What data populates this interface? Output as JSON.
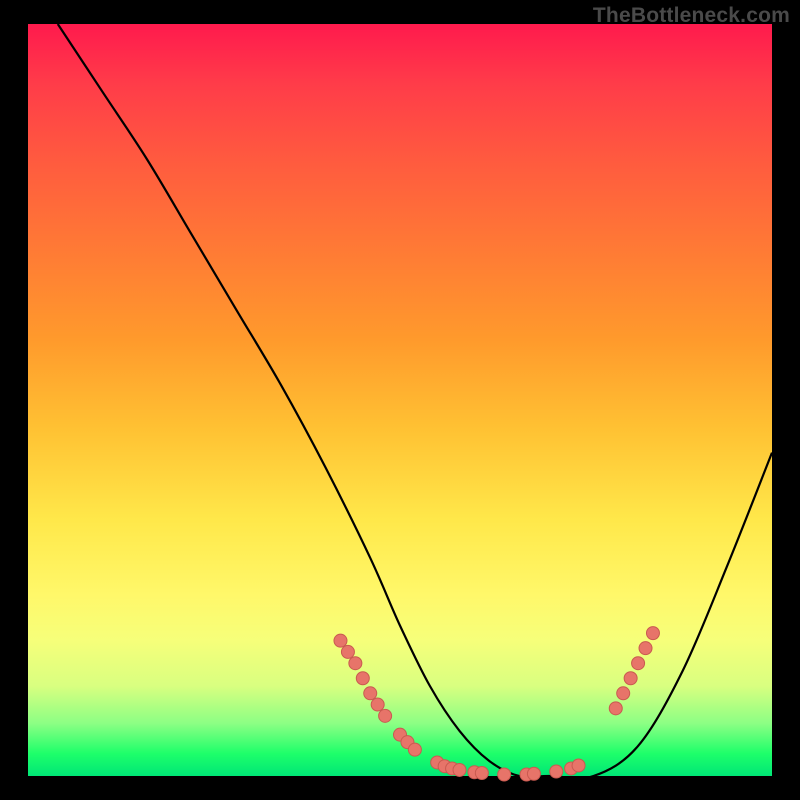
{
  "watermark": "TheBottleneck.com",
  "colors": {
    "frame": "#000000",
    "curve": "#000000",
    "marker_fill": "#e77469",
    "marker_stroke": "#c95a50"
  },
  "chart_data": {
    "type": "line",
    "title": "",
    "xlabel": "",
    "ylabel": "",
    "xlim": [
      0,
      100
    ],
    "ylim": [
      0,
      100
    ],
    "x": [
      4,
      10,
      16,
      22,
      28,
      34,
      40,
      46,
      50,
      54,
      58,
      62,
      66,
      70,
      76,
      82,
      88,
      94,
      100
    ],
    "values": [
      100,
      91,
      82,
      72,
      62,
      52,
      41,
      29,
      20,
      12,
      6,
      2,
      0,
      0,
      0,
      4,
      14,
      28,
      43
    ],
    "series": [
      {
        "name": "bottleneck-curve",
        "x": [
          4,
          10,
          16,
          22,
          28,
          34,
          40,
          46,
          50,
          54,
          58,
          62,
          66,
          70,
          76,
          82,
          88,
          94,
          100
        ],
        "values": [
          100,
          91,
          82,
          72,
          62,
          52,
          41,
          29,
          20,
          12,
          6,
          2,
          0,
          0,
          0,
          4,
          14,
          28,
          43
        ]
      }
    ],
    "markers": [
      {
        "x": 42,
        "y": 18
      },
      {
        "x": 43,
        "y": 16.5
      },
      {
        "x": 44,
        "y": 15
      },
      {
        "x": 45,
        "y": 13
      },
      {
        "x": 46,
        "y": 11
      },
      {
        "x": 47,
        "y": 9.5
      },
      {
        "x": 48,
        "y": 8
      },
      {
        "x": 50,
        "y": 5.5
      },
      {
        "x": 51,
        "y": 4.5
      },
      {
        "x": 52,
        "y": 3.5
      },
      {
        "x": 55,
        "y": 1.8
      },
      {
        "x": 56,
        "y": 1.3
      },
      {
        "x": 57,
        "y": 1
      },
      {
        "x": 58,
        "y": 0.8
      },
      {
        "x": 60,
        "y": 0.5
      },
      {
        "x": 61,
        "y": 0.4
      },
      {
        "x": 64,
        "y": 0.2
      },
      {
        "x": 67,
        "y": 0.2
      },
      {
        "x": 68,
        "y": 0.3
      },
      {
        "x": 71,
        "y": 0.6
      },
      {
        "x": 73,
        "y": 1
      },
      {
        "x": 74,
        "y": 1.4
      },
      {
        "x": 79,
        "y": 9
      },
      {
        "x": 80,
        "y": 11
      },
      {
        "x": 81,
        "y": 13
      },
      {
        "x": 82,
        "y": 15
      },
      {
        "x": 83,
        "y": 17
      },
      {
        "x": 84,
        "y": 19
      }
    ]
  }
}
